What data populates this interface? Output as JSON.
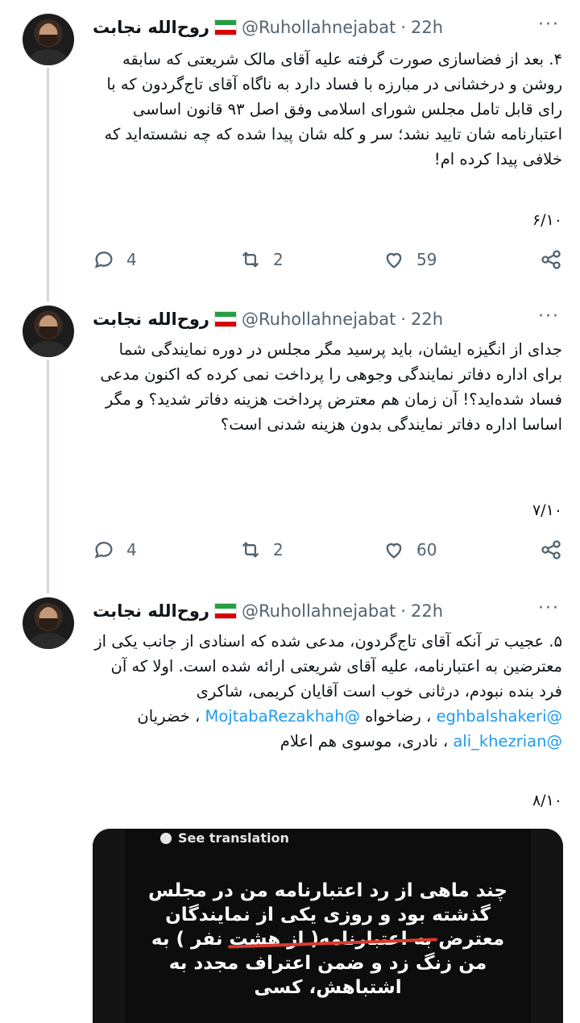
{
  "tweets": [
    {
      "name": "روح‌الله نجابت",
      "handle": "@Ruhollahnejabat",
      "time": "22h",
      "more": "···",
      "text": "۴. بعد از فضاسازی صورت گرفته علیه آقای مالک شریعتی که سابقه روشن و درخشانی در مبارزه با فساد دارد به ناگاه آقای تاج‌گردون که با رای قابل تامل مجلس شورای اسلامی وفق اصل ۹۳ قانون اساسی اعتبارنامه شان تایید نشد؛ سر و کله شان پیدا شده که چه نشسته‌اید که خلافی پیدا کرده ام!",
      "count": "۶/۱۰",
      "replies": "4",
      "retweets": "2",
      "likes": "59"
    },
    {
      "name": "روح‌الله نجابت",
      "handle": "@Ruhollahnejabat",
      "time": "22h",
      "more": "···",
      "text": "جدای از انگیزه ایشان، باید پرسید مگر مجلس در دوره نمایندگی شما برای اداره دفاتر نمایندگی وجوهی را پرداخت نمی کرده که اکنون مدعی فساد شده‌اید؟! آن زمان هم معترض پرداخت هزینه دفاتر شدید؟ و مگر اساسا اداره دفاتر نمایندگی بدون هزینه شدنی است؟",
      "count": "۷/۱۰",
      "replies": "4",
      "retweets": "2",
      "likes": "60"
    },
    {
      "name": "روح‌الله نجابت",
      "handle": "@Ruhollahnejabat",
      "time": "22h",
      "more": "···",
      "text_a": "۵. عجیب تر آنکه آقای تاج‌گردون، مدعی شده که اسنادی از جانب یکی از معترضین به اعتبارنامه، علیه آقای شریعتی ارائه شده است. اولا که آن فرد بنده نبودم، درثانی خوب است آقایان کریمی، شاکری",
      "mention1": "@eghbalshakeri",
      "text_b": " ، رضاخواه ",
      "mention2": "@MojtabaRezakhah",
      "text_c": " ، خضریان ",
      "mention3": "@ali_khezrian",
      "text_d": " ، نادری، موسوی هم اعلام",
      "count": "۸/۱۰",
      "media": {
        "translate_label": "See translation",
        "image_text": "چند ماهی از رد اعتبارنامه من در مجلس گذشته بود و روزی یکی از نمایندگان معترض به اعتبارنامه( از هشت نفر ) به من زنگ زد و ضمن اعتراف مجدد به اشتباهش، کسی"
      }
    }
  ],
  "icons": {
    "reply": "reply-icon",
    "retweet": "retweet-icon",
    "like": "heart-icon",
    "share": "share-icon",
    "more": "more-icon"
  },
  "colors": {
    "mention": "#1d9bf0",
    "muted": "#536471",
    "thread_line": "#cfd9de"
  }
}
